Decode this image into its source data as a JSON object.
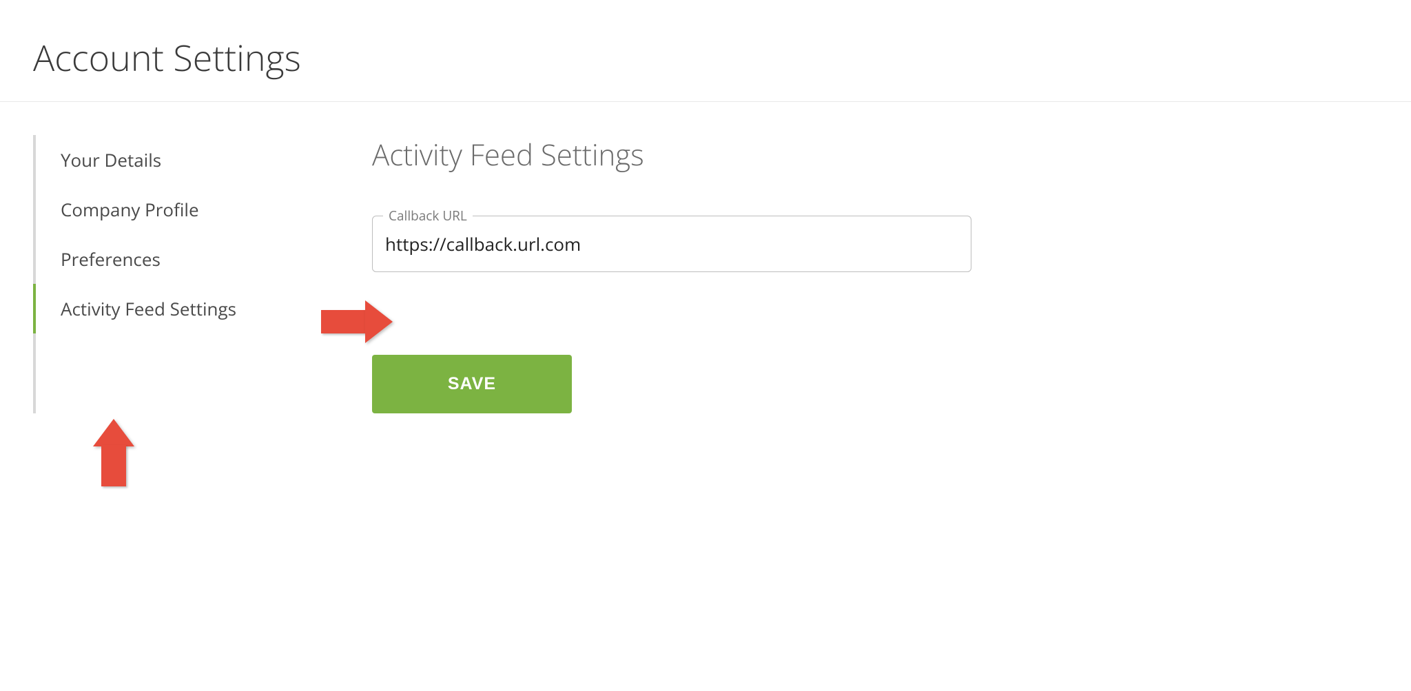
{
  "page": {
    "title": "Account Settings"
  },
  "sidebar": {
    "items": [
      {
        "label": "Your Details",
        "active": false
      },
      {
        "label": "Company Profile",
        "active": false
      },
      {
        "label": "Preferences",
        "active": false
      },
      {
        "label": "Activity Feed Settings",
        "active": true
      }
    ]
  },
  "main": {
    "section_title": "Activity Feed Settings",
    "callback_url_field": {
      "label": "Callback URL",
      "value": "https://callback.url.com"
    },
    "save_label": "SAVE"
  },
  "colors": {
    "accent_green": "#7cb342",
    "annotation_red": "#e74c3c"
  }
}
